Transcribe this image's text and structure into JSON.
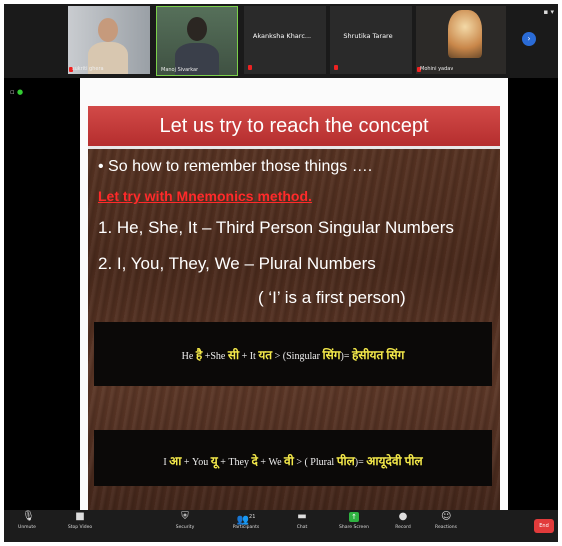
{
  "participants": [
    {
      "name": "sukriti ghera",
      "type": "video"
    },
    {
      "name": "Manoj Sivarkar",
      "type": "video"
    },
    {
      "name": "Akanksha Kharc...",
      "type": "text"
    },
    {
      "name": "Shrutika Tarare",
      "type": "text"
    },
    {
      "name": "Mohini yadav",
      "type": "video"
    }
  ],
  "slide": {
    "title": "Let us try to reach the concept",
    "bullet": "• So how to remember those things ….",
    "method": "Let try with Mnemonics method.",
    "point1": "1.  He, She, It – Third Person Singular  Numbers",
    "point2": "2.  I, You, They, We – Plural Numbers",
    "note": "( ‘I’ is a first person)",
    "box1": {
      "p1": "He ",
      "h1": "है",
      "p2": " +She ",
      "h2": "सी",
      "p3": " + It ",
      "h3": "यत",
      "p4": " > (Singular ",
      "h4": "सिंग",
      "p5": ")= ",
      "h5": "हेसीयत सिंग"
    },
    "box2": {
      "p1": "I ",
      "h1": "आ",
      "p2": " + You ",
      "h2": "यू",
      "p3": " + They ",
      "h3": "दे",
      "p4": " + We ",
      "h4": "वी",
      "p5": " > ( Plural ",
      "h5": "पील",
      "p6": ")= ",
      "h6": "आयूदेवी पील"
    }
  },
  "toolbar": {
    "unmute": "Unmute",
    "start_video": "Stop Video",
    "security": "Security",
    "participants": "Participants",
    "participants_count": "21",
    "chat": "Chat",
    "share_screen": "Share Screen",
    "record": "Record",
    "reactions": "Reactions",
    "end": "End"
  },
  "colors": {
    "slide_title_bar": "#c93c3b",
    "method_text": "#ff2a2a",
    "highlight": "#f4e94a",
    "share_screen": "#2fb341",
    "end_button": "#e23b3b"
  }
}
